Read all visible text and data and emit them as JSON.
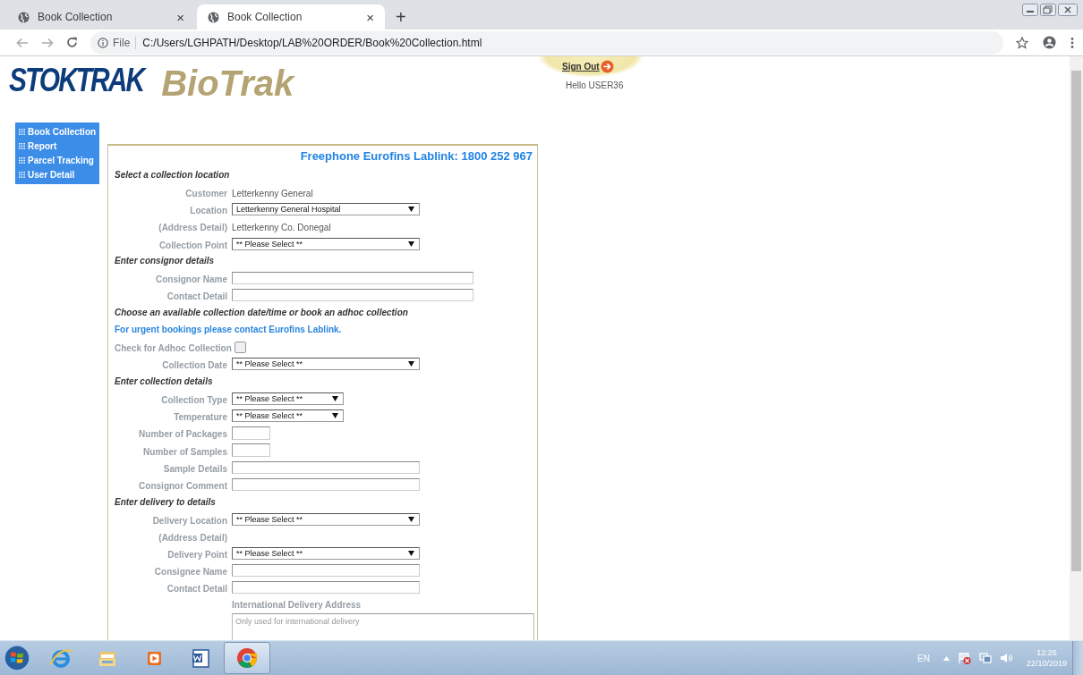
{
  "browser": {
    "tabs": [
      {
        "title": "Book Collection",
        "close": "×",
        "selected": false
      },
      {
        "title": "Book Collection",
        "close": "×",
        "selected": true
      }
    ],
    "new_tab": "+",
    "address": {
      "scheme": "File",
      "url": "C:/Users/LGHPATH/Desktop/LAB%20ORDER/Book%20Collection.html"
    }
  },
  "page": {
    "logo": {
      "brand": "STOKTRAK",
      "product": "BioTrak"
    },
    "sign_out": "Sign Out",
    "greeting": "Hello USER36",
    "nav": [
      {
        "label": "Book Collection"
      },
      {
        "label": "Report"
      },
      {
        "label": "Parcel Tracking"
      },
      {
        "label": "User Detail"
      }
    ],
    "form": {
      "heading": "Freephone Eurofins Lablink: 1800 252 967",
      "rows": [
        {
          "kind": "section",
          "text": "Select a collection location"
        },
        {
          "kind": "display",
          "label": "Customer",
          "value": "Letterkenny General"
        },
        {
          "kind": "select",
          "label": "Location",
          "value": "Letterkenny General Hospital"
        },
        {
          "kind": "display",
          "label": "(Address Detail)",
          "value": "Letterkenny Co. Donegal"
        },
        {
          "kind": "select",
          "label": "Collection Point",
          "value": "** Please Select **"
        },
        {
          "kind": "section",
          "text": "Enter consignor details"
        },
        {
          "kind": "wide_input",
          "label": "Consignor Name"
        },
        {
          "kind": "wide_input",
          "label": "Contact Detail"
        },
        {
          "kind": "section",
          "text": "Choose an available collection date/time or book an adhoc collection"
        },
        {
          "kind": "note",
          "text": "For urgent bookings please contact Eurofins Lablink."
        },
        {
          "kind": "checkbox",
          "label": "Check for Adhoc Collection",
          "checked": false
        },
        {
          "kind": "select",
          "label": "Collection Date",
          "value": "** Please Select **"
        },
        {
          "kind": "section",
          "text": "Enter collection details"
        },
        {
          "kind": "short_select",
          "label": "Collection Type",
          "value": "** Please Select **"
        },
        {
          "kind": "short_select",
          "label": "Temperature",
          "value": "** Please Select **"
        },
        {
          "kind": "number_input",
          "label": "Number of Packages"
        },
        {
          "kind": "number_input",
          "label": "Number of Samples"
        },
        {
          "kind": "input",
          "label": "Sample Details"
        },
        {
          "kind": "input",
          "label": "Consignor Comment"
        },
        {
          "kind": "section",
          "text": "Enter delivery to details"
        },
        {
          "kind": "select",
          "label": "Delivery Location",
          "value": "** Please Select **"
        },
        {
          "kind": "display",
          "label": "(Address Detail)"
        },
        {
          "kind": "select",
          "label": "Delivery Point",
          "value": "** Please Select **"
        },
        {
          "kind": "input",
          "label": "Consignee Name"
        },
        {
          "kind": "input",
          "label": "Contact Detail"
        },
        {
          "kind": "textarea",
          "label": "International Delivery Address",
          "placeholder": "Only used for international delivery"
        }
      ]
    }
  },
  "taskbar": {
    "apps": [
      {
        "kind": "ie",
        "active": false
      },
      {
        "kind": "folder",
        "active": false
      },
      {
        "kind": "media",
        "active": false
      },
      {
        "kind": "word",
        "active": false
      },
      {
        "kind": "chrome",
        "active": true
      }
    ],
    "tray": {
      "language": "EN",
      "time": "12:26",
      "date": "22/10/2019"
    }
  }
}
